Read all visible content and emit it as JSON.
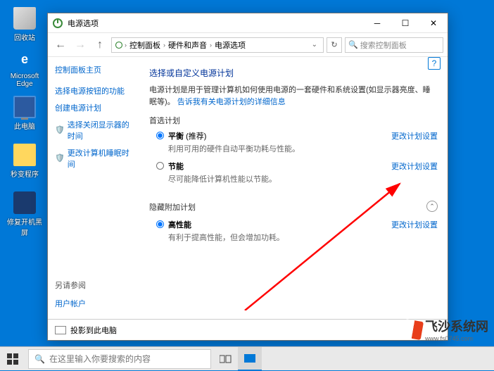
{
  "desktop": {
    "icons": [
      {
        "name": "recycle-bin",
        "label": "回收站"
      },
      {
        "name": "edge",
        "label": "Microsoft Edge"
      },
      {
        "name": "this-pc",
        "label": "此电脑"
      },
      {
        "name": "seconds",
        "label": "秒变程序"
      },
      {
        "name": "repair",
        "label": "修复开机黑屏"
      }
    ]
  },
  "window": {
    "title": "电源选项",
    "breadcrumb": [
      "控制面板",
      "硬件和声音",
      "电源选项"
    ],
    "search_placeholder": "搜索控制面板",
    "sidebar": {
      "home": "控制面板主页",
      "links": [
        "选择电源按钮的功能",
        "创建电源计划",
        "选择关闭显示器的时间",
        "更改计算机睡眠时间"
      ],
      "see_also_label": "另请参阅",
      "see_also": [
        "用户帐户"
      ]
    },
    "main": {
      "heading": "选择或自定义电源计划",
      "description": "电源计划是用于管理计算机如何使用电源的一套硬件和系统设置(如显示器亮度、睡眠等)。",
      "more_link": "告诉我有关电源计划的详细信息",
      "preferred_label": "首选计划",
      "plans": [
        {
          "name": "平衡",
          "recommended": "(推荐)",
          "desc": "利用可用的硬件自动平衡功耗与性能。",
          "change": "更改计划设置",
          "checked": true
        },
        {
          "name": "节能",
          "recommended": "",
          "desc": "尽可能降低计算机性能以节能。",
          "change": "更改计划设置",
          "checked": false
        }
      ],
      "hidden_label": "隐藏附加计划",
      "hidden_plans": [
        {
          "name": "高性能",
          "recommended": "",
          "desc": "有利于提高性能，但会增加功耗。",
          "change": "更改计划设置",
          "checked": true
        }
      ]
    },
    "bottombar": "投影到此电脑"
  },
  "taskbar": {
    "search_placeholder": "在这里输入你要搜索的内容"
  },
  "watermark": {
    "brand": "飞沙系统网",
    "url": "www.fs0745.com"
  }
}
